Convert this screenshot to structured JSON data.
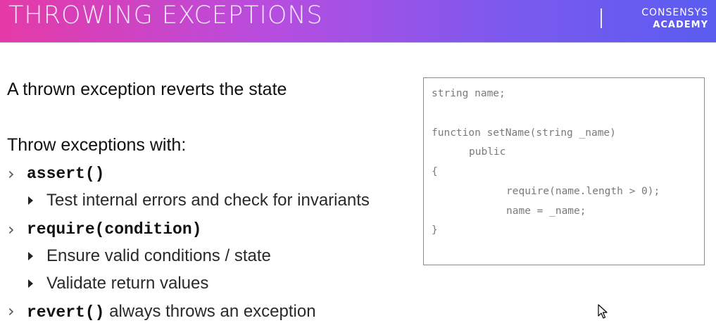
{
  "header": {
    "title": "THROWING EXCEPTIONS",
    "brand_line1": "CONSENSYS",
    "brand_line2": "ACADEMY"
  },
  "content": {
    "statement": "A thrown exception reverts the state",
    "throw_with": "Throw exceptions with:",
    "items": [
      {
        "code": "assert()",
        "text": "",
        "subs": [
          "Test internal errors and check for invariants"
        ]
      },
      {
        "code": "require(condition)",
        "text": "",
        "subs": [
          "Ensure valid conditions / state",
          "Validate return values"
        ]
      },
      {
        "code": "revert()",
        "text": " always throws an exception",
        "subs": []
      }
    ]
  },
  "code_sample": {
    "lines": [
      "string name;",
      "",
      "function setName(string _name)",
      "public",
      "{",
      "require(name.length > 0);",
      "name = _name;",
      "}"
    ]
  },
  "icons": {
    "bullet": "chevron-right-icon",
    "sub_bullet": "triangle-right-icon",
    "pointer": "mouse-cursor-icon"
  },
  "colors": {
    "header_gradient_start": "#e53aa7",
    "header_gradient_end": "#5a5cf0"
  }
}
